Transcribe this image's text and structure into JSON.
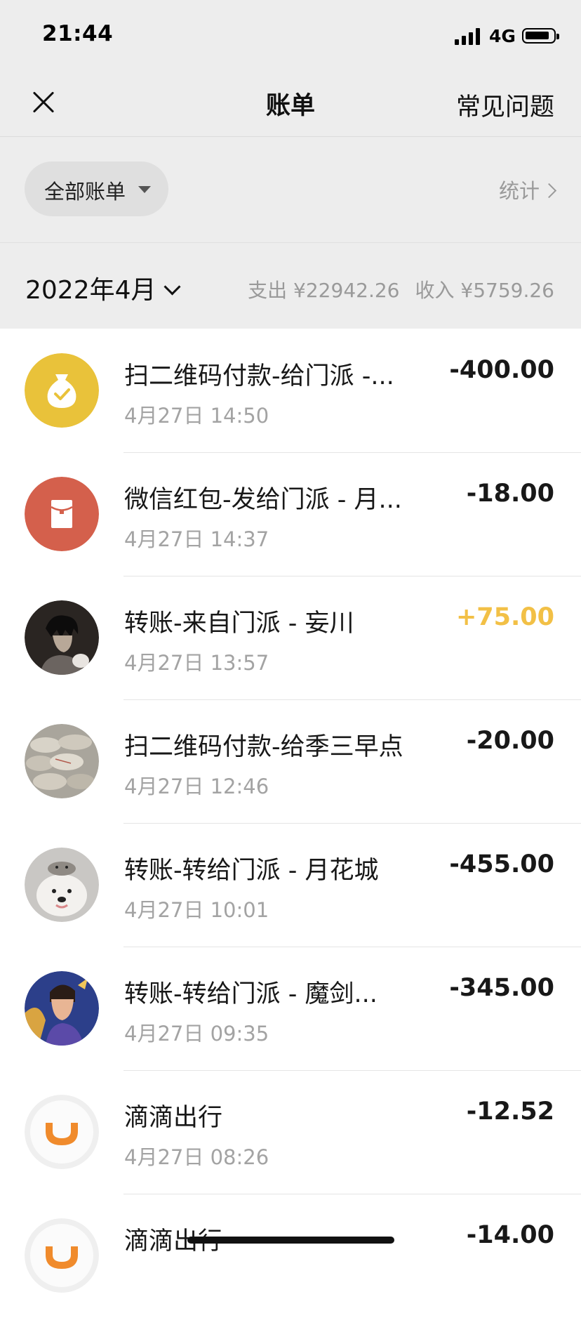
{
  "status_bar": {
    "time": "21:44",
    "network": "4G"
  },
  "nav": {
    "title": "账单",
    "faq_label": "常见问题"
  },
  "filter": {
    "label": "全部账单",
    "stats_label": "统计"
  },
  "month": {
    "label": "2022年4月",
    "expense": "支出 ¥22942.26",
    "income": "收入 ¥5759.26"
  },
  "transactions": [
    {
      "title": "扫二维码付款-给门派 -...",
      "time": "4月27日 14:50",
      "amount": "-400.00",
      "kind": "expense",
      "avatar": "money-bag-icon"
    },
    {
      "title": "微信红包-发给门派 - 月...",
      "time": "4月27日 14:37",
      "amount": "-18.00",
      "kind": "expense",
      "avatar": "red-packet-icon"
    },
    {
      "title": "转账-来自门派 - 妄川",
      "time": "4月27日 13:57",
      "amount": "+75.00",
      "kind": "income",
      "avatar": "anime-character-avatar"
    },
    {
      "title": "扫二维码付款-给季三早点",
      "time": "4月27日 12:46",
      "amount": "-20.00",
      "kind": "expense",
      "avatar": "flour-sacks-avatar"
    },
    {
      "title": "转账-转给门派 - 月花城",
      "time": "4月27日 10:01",
      "amount": "-455.00",
      "kind": "expense",
      "avatar": "dog-with-seal-avatar"
    },
    {
      "title": "转账-转给门派 - 魔剑...",
      "time": "4月27日 09:35",
      "amount": "-345.00",
      "kind": "expense",
      "avatar": "game-hero-avatar"
    },
    {
      "title": "滴滴出行",
      "time": "4月27日 08:26",
      "amount": "-12.52",
      "kind": "expense",
      "avatar": "didi-logo-icon"
    },
    {
      "title": "滴滴出行",
      "time": "",
      "amount": "-14.00",
      "kind": "expense",
      "avatar": "didi-logo-icon"
    }
  ],
  "colors": {
    "header_bg": "#ededed",
    "income": "#f2c046",
    "money_bag": "#e9c23a",
    "red_packet": "#d4604c",
    "didi_orange": "#f08b2c"
  }
}
